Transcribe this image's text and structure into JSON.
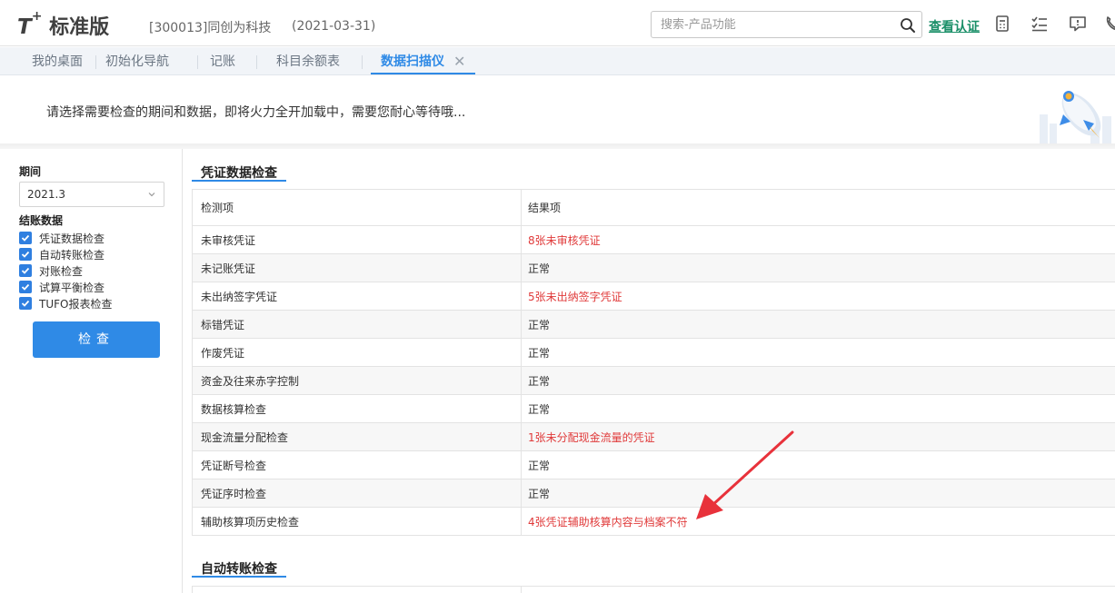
{
  "header": {
    "logo_brand": "T",
    "logo_plus": "+",
    "logo_edition": "标准版",
    "company": "[300013]同创为科技",
    "date": "(2021-03-31)",
    "search_placeholder": "搜索-产品功能",
    "cert_link": "查看认证",
    "icons": [
      "calculator-icon",
      "checklist-icon",
      "message-icon",
      "phone-icon"
    ]
  },
  "tabs": [
    {
      "label": "我的桌面"
    },
    {
      "label": "初始化导航"
    },
    {
      "label": "记账"
    },
    {
      "label": "科目余额表"
    },
    {
      "label": "数据扫描仪",
      "active": true
    }
  ],
  "banner": {
    "text": "请选择需要检查的期间和数据，即将火力全开加载中，需要您耐心等待哦..."
  },
  "left_panel": {
    "period_label": "期间",
    "period_value": "2021.3",
    "closing_label": "结账数据",
    "checks": [
      {
        "label": "凭证数据检查",
        "checked": true
      },
      {
        "label": "自动转账检查",
        "checked": true
      },
      {
        "label": "对账检查",
        "checked": true
      },
      {
        "label": "试算平衡检查",
        "checked": true
      },
      {
        "label": "TUFO报表检查",
        "checked": true
      }
    ],
    "check_button": "检查"
  },
  "main": {
    "section1_title": "凭证数据检查",
    "col_item": "检测项",
    "col_result": "结果项",
    "rows": [
      {
        "item": "未审核凭证",
        "result": "8张未审核凭证",
        "warn": true
      },
      {
        "item": "未记账凭证",
        "result": "正常",
        "warn": false
      },
      {
        "item": "未出纳签字凭证",
        "result": "5张未出纳签字凭证",
        "warn": true
      },
      {
        "item": "标错凭证",
        "result": "正常",
        "warn": false
      },
      {
        "item": "作废凭证",
        "result": "正常",
        "warn": false
      },
      {
        "item": "资金及往来赤字控制",
        "result": "正常",
        "warn": false
      },
      {
        "item": "数据核算检查",
        "result": "正常",
        "warn": false
      },
      {
        "item": "现金流量分配检查",
        "result": "1张未分配现金流量的凭证",
        "warn": true
      },
      {
        "item": "凭证断号检查",
        "result": "正常",
        "warn": false
      },
      {
        "item": "凭证序时检查",
        "result": "正常",
        "warn": false
      },
      {
        "item": "辅助核算项历史检查",
        "result": "4张凭证辅助核算内容与档案不符",
        "warn": true
      }
    ],
    "section2_title": "自动转账检查"
  },
  "colors": {
    "accent": "#2f8ae6",
    "warn": "#e03a3a",
    "link": "#1a8f68",
    "annotation": "#e8323b"
  }
}
